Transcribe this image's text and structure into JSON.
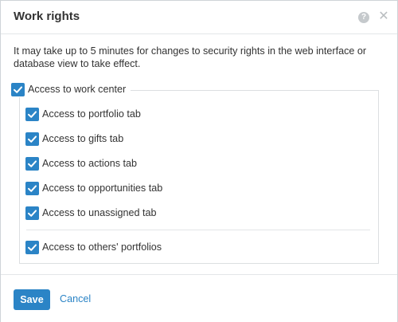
{
  "dialog": {
    "title": "Work rights",
    "help_icon": "question-circle",
    "help_glyph": "?",
    "close_icon": "close",
    "close_glyph": "✕"
  },
  "notice": "It may take up to 5 minutes for changes to security rights in the web interface or database view to take effect.",
  "parent_option": {
    "label": "Access to work center",
    "checked": true
  },
  "options": [
    {
      "label": "Access to portfolio tab",
      "checked": true
    },
    {
      "label": "Access to gifts tab",
      "checked": true
    },
    {
      "label": "Access to actions tab",
      "checked": true
    },
    {
      "label": "Access to opportunities tab",
      "checked": true
    },
    {
      "label": "Access to unassigned tab",
      "checked": true
    },
    {
      "label": "Access to others' portfolios",
      "checked": true
    }
  ],
  "footer": {
    "save_label": "Save",
    "cancel_label": "Cancel"
  },
  "colors": {
    "accent": "#2b84c6",
    "text": "#333333",
    "border": "#dcdfe1"
  }
}
